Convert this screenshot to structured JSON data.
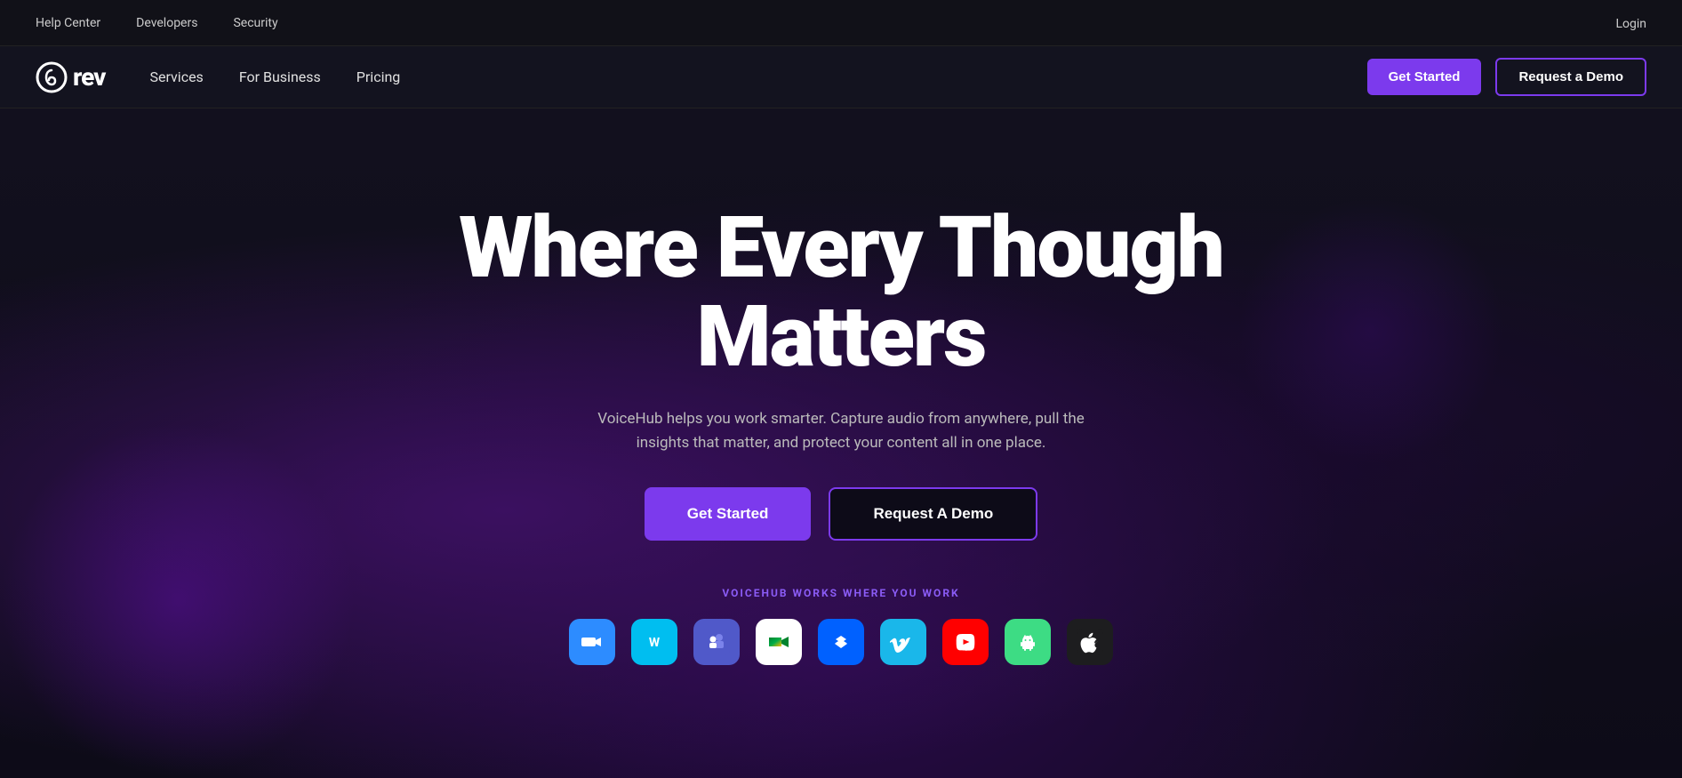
{
  "topbar": {
    "links": [
      "Help Center",
      "Developers",
      "Security"
    ],
    "login": "Login"
  },
  "nav": {
    "logo_text": "rev",
    "links": [
      "Services",
      "For Business",
      "Pricing"
    ],
    "cta_primary": "Get Started",
    "cta_secondary": "Request a Demo"
  },
  "hero": {
    "title": "Where Every Though Matters",
    "subtitle": "VoiceHub helps you work smarter. Capture audio from anywhere, pull the insights that matter, and protect your content all in one place.",
    "btn_primary": "Get Started",
    "btn_secondary": "Request A Demo",
    "works_label": "VOICEHUB WORKS WHERE YOU WORK",
    "integrations": [
      {
        "name": "Zoom",
        "key": "zoom"
      },
      {
        "name": "Webex",
        "key": "webex"
      },
      {
        "name": "Microsoft Teams",
        "key": "teams"
      },
      {
        "name": "Google Meet",
        "key": "meet"
      },
      {
        "name": "Dropbox",
        "key": "dropbox"
      },
      {
        "name": "Vimeo",
        "key": "vimeo"
      },
      {
        "name": "YouTube",
        "key": "youtube"
      },
      {
        "name": "Android",
        "key": "android"
      },
      {
        "name": "Apple",
        "key": "apple"
      }
    ]
  }
}
